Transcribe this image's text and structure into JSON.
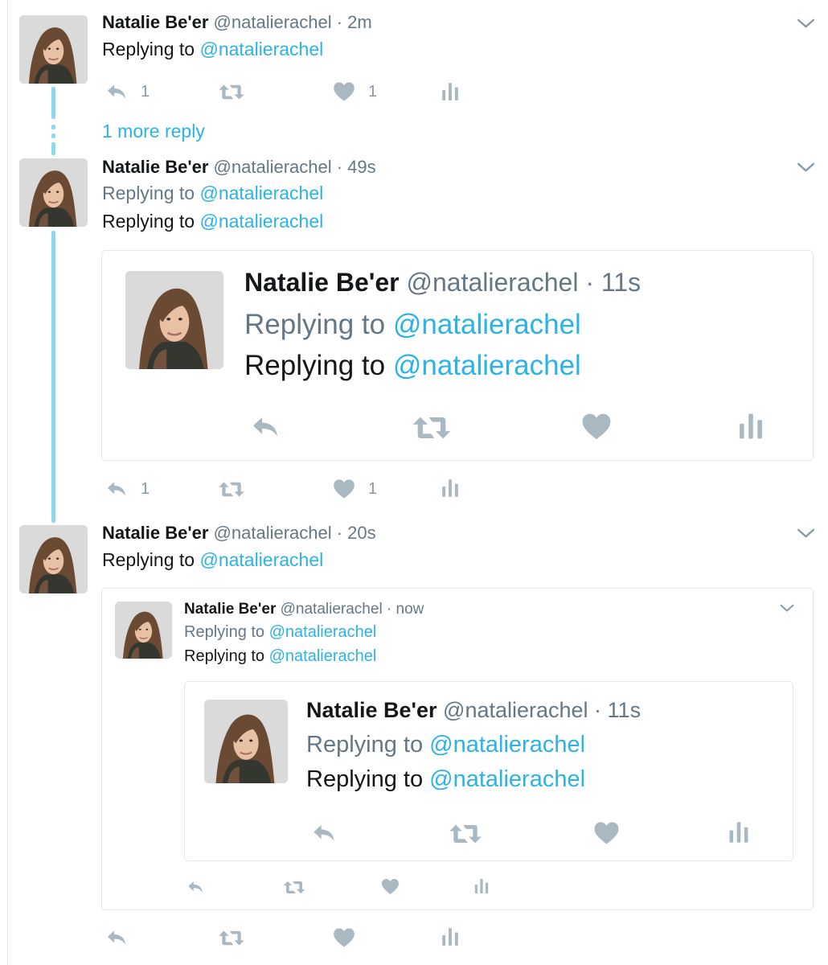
{
  "colors": {
    "accent": "#2bb3e6",
    "icon_gray": "#aab8c2",
    "thread_line": "#8ed7ef",
    "name_text": "#14171a",
    "meta_text": "#657786"
  },
  "tweet1": {
    "name": "Natalie Be'er",
    "meta": "@natalierachel · 2m",
    "reply_label": "Replying to ",
    "reply_handle": "@natalierachel",
    "reply_count": "1",
    "like_count": "1"
  },
  "more_replies": "1 more reply",
  "tweet2": {
    "name": "Natalie Be'er",
    "meta": "@natalierachel · 49s",
    "lines": [
      {
        "label": "Replying to ",
        "handle": "@natalierachel"
      },
      {
        "label": "Replying to ",
        "handle": "@natalierachel"
      }
    ],
    "quote": {
      "name": "Natalie Be'er",
      "meta": "@natalierachel · 11s",
      "lines": [
        {
          "label": "Replying to ",
          "handle": "@natalierachel"
        },
        {
          "label": "Replying to ",
          "handle": "@natalierachel"
        }
      ]
    },
    "reply_count": "1",
    "like_count": "1"
  },
  "tweet3": {
    "name": "Natalie Be'er",
    "meta": "@natalierachel · 20s",
    "reply_label": "Replying to ",
    "reply_handle": "@natalierachel",
    "quote": {
      "name": "Natalie Be'er",
      "meta": "@natalierachel · now",
      "lines": [
        {
          "label": "Replying to ",
          "handle": "@natalierachel"
        },
        {
          "label": "Replying to ",
          "handle": "@natalierachel"
        }
      ],
      "inner_quote": {
        "name": "Natalie Be'er",
        "meta": "@natalierachel · 11s",
        "lines": [
          {
            "label": "Replying to ",
            "handle": "@natalierachel"
          },
          {
            "label": "Replying to ",
            "handle": "@natalierachel"
          }
        ]
      }
    }
  },
  "icons": {
    "reply": "reply-icon",
    "retweet": "retweet-icon",
    "like": "heart-icon",
    "analytics": "analytics-icon",
    "more": "chevron-down-icon"
  }
}
